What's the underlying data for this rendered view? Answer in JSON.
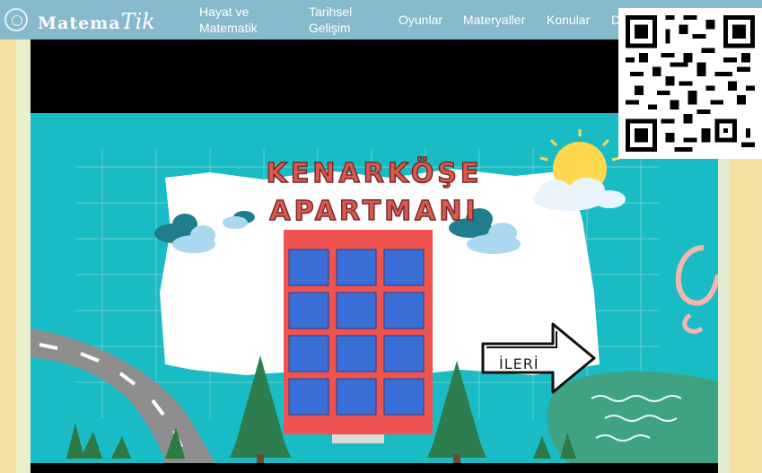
{
  "brand": {
    "main": "Matema",
    "script": "Tik"
  },
  "nav": {
    "hayat": [
      "Hayat ve",
      "Matematik"
    ],
    "tarih": [
      "Tarihsel",
      "Gelişim"
    ],
    "oyunlar": "Oyunlar",
    "materyaller": "Materyaller",
    "konular": "Konular",
    "more": "D"
  },
  "game": {
    "title_line1": "KENARKÖŞE",
    "title_line2": "APARTMANI",
    "next_button": "İLERİ"
  },
  "colors": {
    "navbar": "#86b9cc",
    "scene_bg": "#19bcc4",
    "title": "#d95a50",
    "building": "#ef5350",
    "window": "#3a6fd8",
    "tree": "#2e7d4f"
  }
}
